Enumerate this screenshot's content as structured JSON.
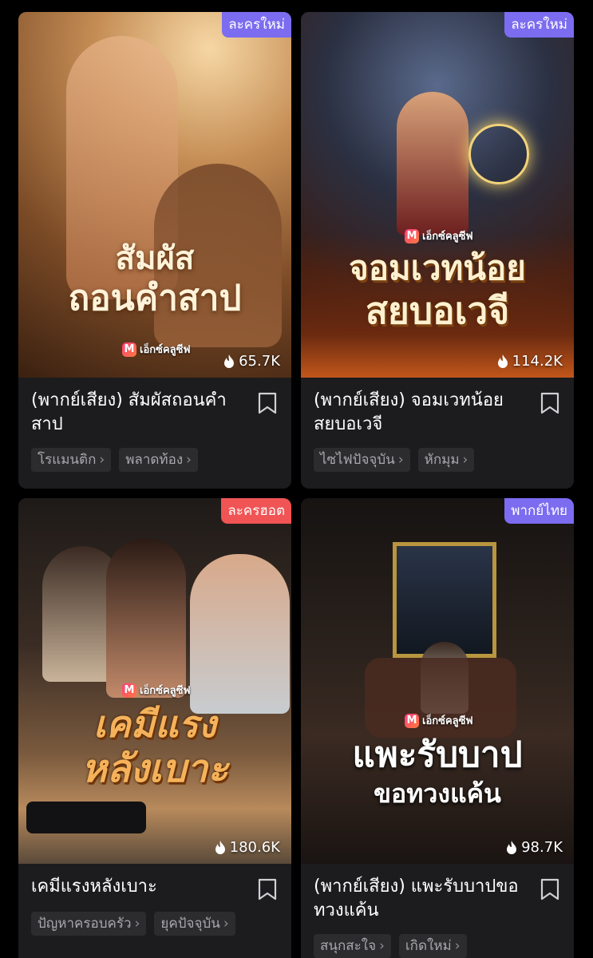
{
  "cards": [
    {
      "badge": "ละครใหม่",
      "badge_color": "#7b6cf0",
      "cover_line1": "สัมผัส",
      "cover_line2": "ถอนคำสาป",
      "brand": "เอ็กซ์คลูซีฟ",
      "views": "65.7K",
      "title": "(พากย์เสียง) สัมผัสถอนคำสาป",
      "tags": [
        "โรแมนติก",
        "พลาดท้อง"
      ]
    },
    {
      "badge": "ละครใหม่",
      "badge_color": "#7b6cf0",
      "cover_line1": "จอมเวทน้อย",
      "cover_line2": "สยบอเวจี",
      "brand": "เอ็กซ์คลูซีฟ",
      "views": "114.2K",
      "title": "(พากย์เสียง) จอมเวทน้อยสยบอเวจี",
      "tags": [
        "ไซไฟปัจจุบัน",
        "หักมุม"
      ]
    },
    {
      "badge": "ละครฮอต",
      "badge_color": "#f05454",
      "cover_line1": "เคมีแรง",
      "cover_line2": "หลังเบาะ",
      "brand": "เอ็กซ์คลูซีฟ",
      "views": "180.6K",
      "title": "เคมีแรงหลังเบาะ",
      "tags": [
        "ปัญหาครอบครัว",
        "ยุคปัจจุบัน"
      ]
    },
    {
      "badge": "พากย์ไทย",
      "badge_color": "#7b6cf0",
      "cover_line1": "แพะรับบาป",
      "cover_line2": "ขอทวงแค้น",
      "brand": "เอ็กซ์คลูซีฟ",
      "views": "98.7K",
      "title": "(พากย์เสียง) แพะรับบาปขอทวงแค้น",
      "tags": [
        "สนุกสะใจ",
        "เกิดใหม่"
      ]
    }
  ]
}
